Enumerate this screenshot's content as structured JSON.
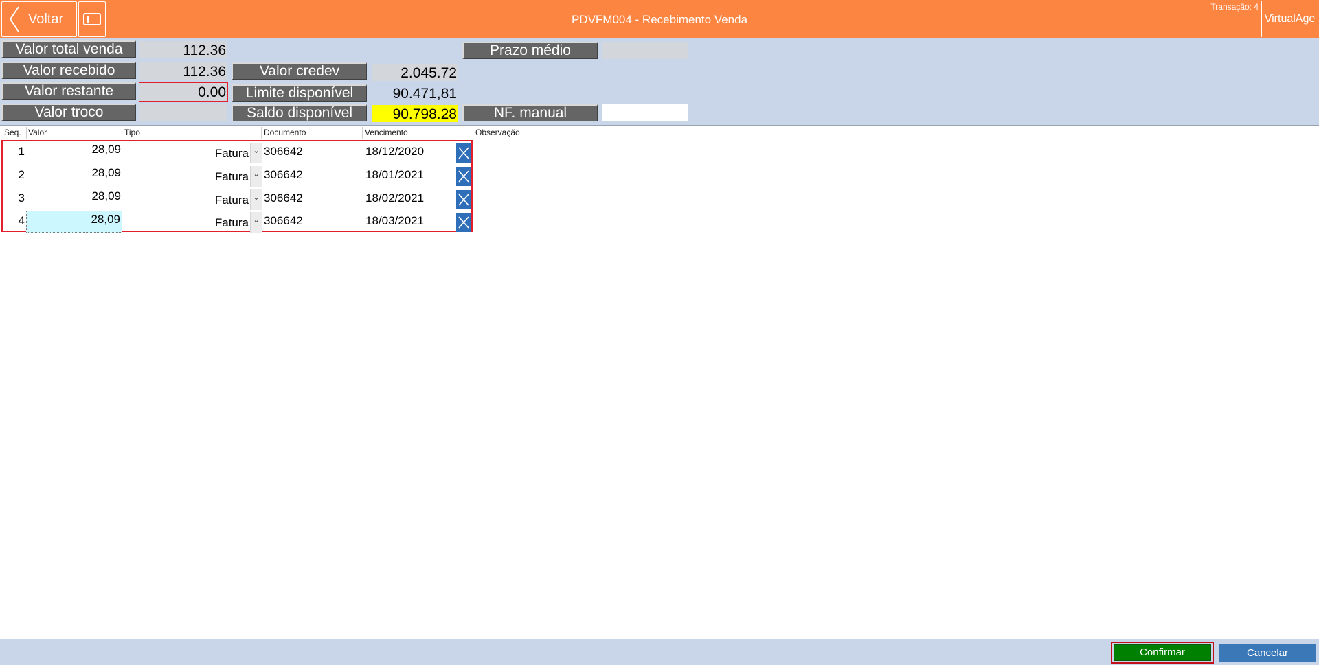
{
  "header": {
    "back_label": "Voltar",
    "title": "PDVFM004 - Recebimento Venda",
    "transacao": "Transação: 4",
    "app_label": "VirtualAge",
    "bg_color": "#fd8542"
  },
  "summary": {
    "valor_total_venda": {
      "label": "Valor total venda",
      "value": "112.36"
    },
    "valor_recebido": {
      "label": "Valor recebido",
      "value": "112.36"
    },
    "valor_restante": {
      "label": "Valor restante",
      "value": "0.00"
    },
    "valor_troco": {
      "label": "Valor troco",
      "value": ""
    },
    "valor_credev": {
      "label": "Valor credev",
      "value": "2.045.72"
    },
    "limite_disponivel": {
      "label": "Limite disponível",
      "value": "90.471,81"
    },
    "saldo_disponivel": {
      "label": "Saldo disponível",
      "value": "90.798.28"
    },
    "prazo_medio": {
      "label": "Prazo médio",
      "value": ""
    },
    "nf_manual": {
      "label": "NF. manual",
      "value": ""
    }
  },
  "grid": {
    "columns": [
      "Seq.",
      "Valor",
      "Tipo",
      "Documento",
      "Vencimento",
      "Observação"
    ],
    "rows": [
      {
        "seq": "1",
        "valor": "28,09",
        "tipo": "Fatura",
        "documento": "306642",
        "vencimento": "18/12/2020",
        "observacao": ""
      },
      {
        "seq": "2",
        "valor": "28,09",
        "tipo": "Fatura",
        "documento": "306642",
        "vencimento": "18/01/2021",
        "observacao": ""
      },
      {
        "seq": "3",
        "valor": "28,09",
        "tipo": "Fatura",
        "documento": "306642",
        "vencimento": "18/02/2021",
        "observacao": ""
      },
      {
        "seq": "4",
        "valor": "28,09",
        "tipo": "Fatura",
        "documento": "306642",
        "vencimento": "18/03/2021",
        "observacao": ""
      }
    ]
  },
  "footer": {
    "confirm_label": "Confirmar",
    "cancel_label": "Cancelar",
    "confirm_color": "#008000",
    "cancel_color": "#3a78b8"
  }
}
